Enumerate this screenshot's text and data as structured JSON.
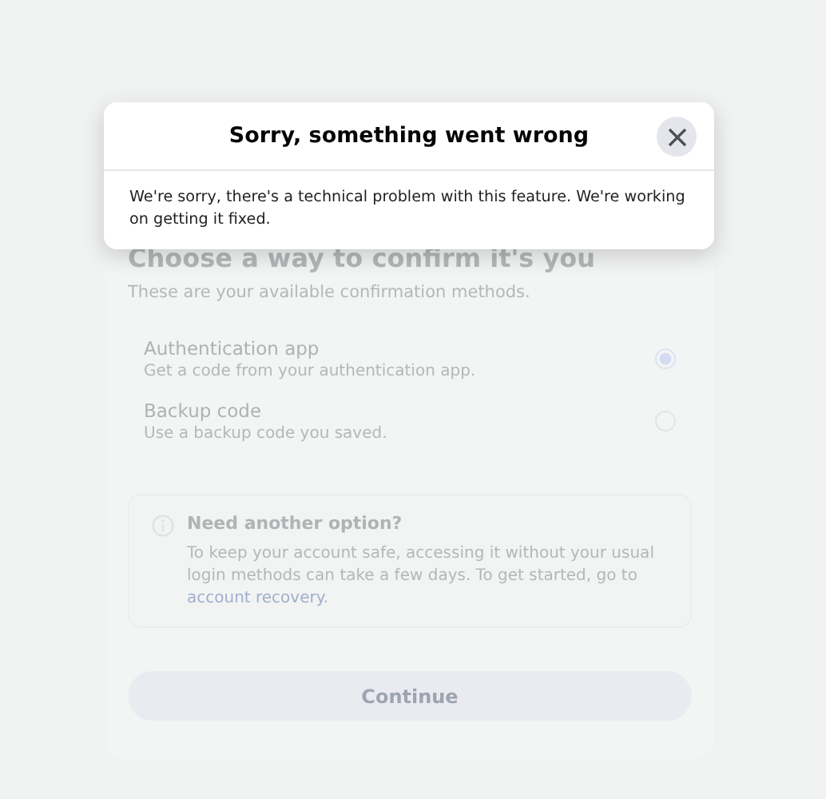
{
  "dialog": {
    "title": "Sorry, something went wrong",
    "message": "We're sorry, there's a technical problem with this feature. We're working on getting it fixed."
  },
  "page": {
    "title": "Choose a way to confirm it's you",
    "subtitle": "These are your available confirmation methods.",
    "options": [
      {
        "label": "Authentication app",
        "description": "Get a code from your authentication app.",
        "selected": true
      },
      {
        "label": "Backup code",
        "description": "Use a backup code you saved.",
        "selected": false
      }
    ],
    "notice": {
      "title": "Need another option?",
      "text": "To keep your account safe, accessing it without your usual login methods can take a few days. To get started, go to",
      "link": "account recovery",
      "end": "."
    },
    "button": "Continue"
  }
}
